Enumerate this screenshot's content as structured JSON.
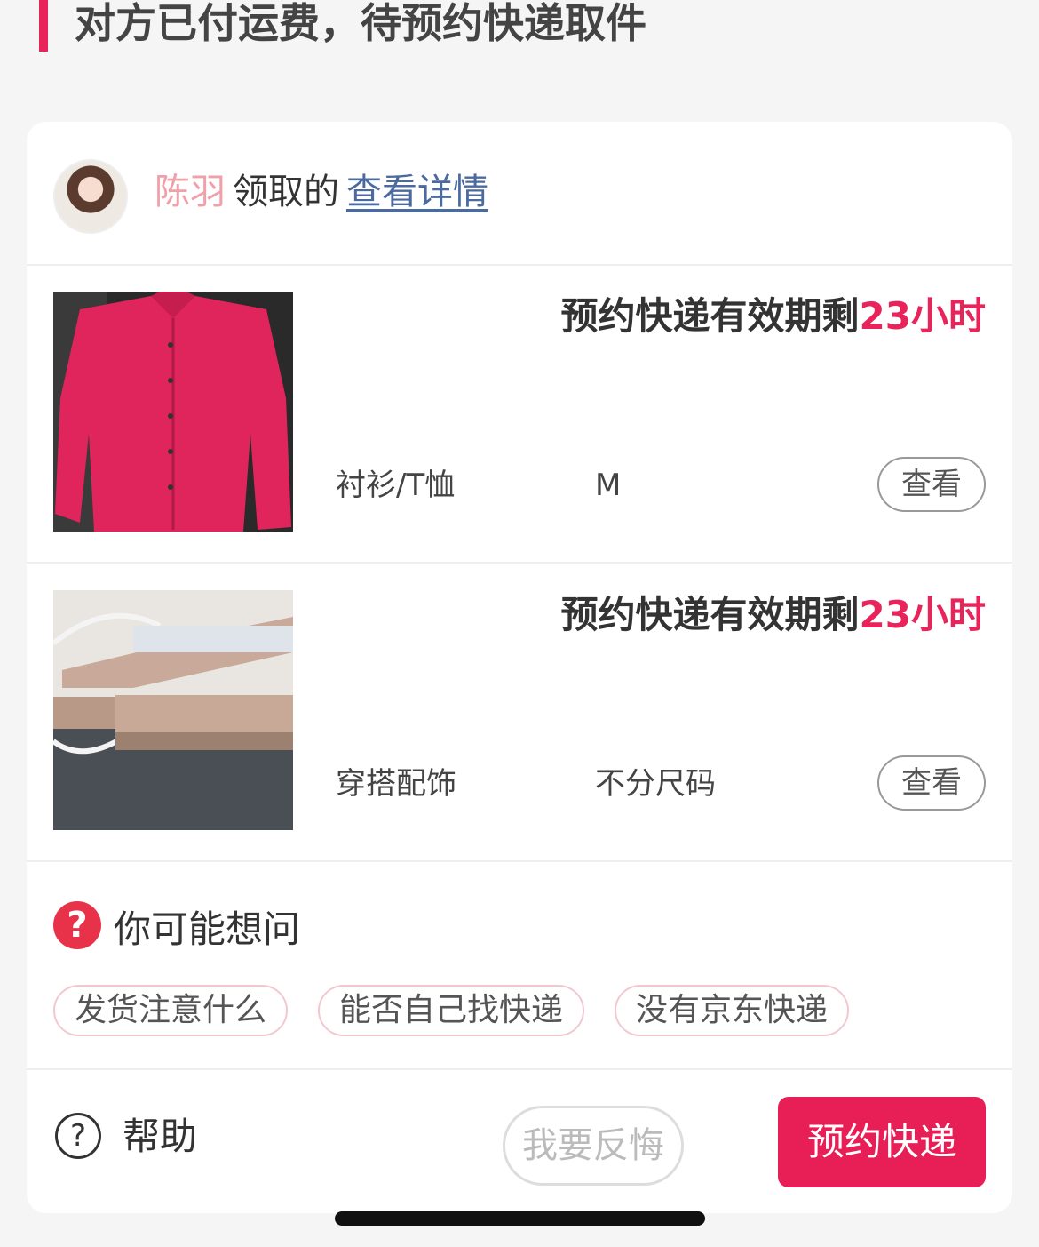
{
  "header": {
    "status_title": "对方已付运费，待预约快递取件"
  },
  "claimer": {
    "name": "陈羽",
    "verb": "领取的",
    "detail_link": "查看详情"
  },
  "items": [
    {
      "validity_prefix": "预约快递有效期剩",
      "validity_remaining": "23小时",
      "category": "衬衫/T恤",
      "size": "M",
      "view_label": "查看"
    },
    {
      "validity_prefix": "预约快递有效期剩",
      "validity_remaining": "23小时",
      "category": "穿搭配饰",
      "size": "不分尺码",
      "view_label": "查看"
    }
  ],
  "faq": {
    "title": "你可能想问",
    "chips": [
      "发货注意什么",
      "能否自己找快递",
      "没有京东快递"
    ]
  },
  "footer": {
    "help_label": "帮助",
    "regret_label": "我要反悔",
    "book_label": "预约快递"
  },
  "colors": {
    "accent": "#e81f56",
    "name": "#f0a0a8",
    "link": "#4a6aa0"
  }
}
